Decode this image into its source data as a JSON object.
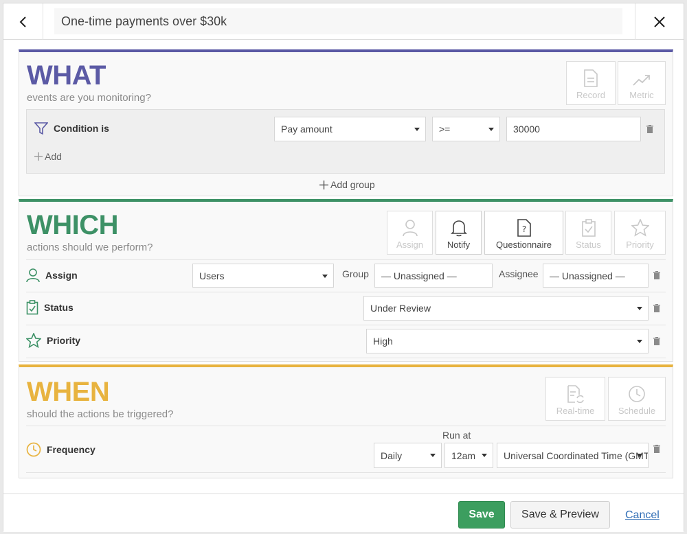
{
  "header": {
    "title": "One-time payments over $30k"
  },
  "what": {
    "title": "WHAT",
    "subtitle": "events are you monitoring?",
    "type_buttons": [
      {
        "label": "Record",
        "icon": "document-icon"
      },
      {
        "label": "Metric",
        "icon": "trend-icon"
      }
    ],
    "condition": {
      "label": "Condition is",
      "field": "Pay amount",
      "operator": ">=",
      "value": "30000"
    },
    "add_label": "Add",
    "add_group_label": "Add group"
  },
  "which": {
    "title": "WHICH",
    "subtitle": "actions should we perform?",
    "action_buttons": [
      {
        "label": "Assign",
        "icon": "user-icon"
      },
      {
        "label": "Notify",
        "icon": "bell-icon"
      },
      {
        "label": "Questionnaire",
        "icon": "question-doc-icon"
      },
      {
        "label": "Status",
        "icon": "clipboard-check-icon"
      },
      {
        "label": "Priority",
        "icon": "star-icon"
      }
    ],
    "assign": {
      "label": "Assign",
      "type": "Users",
      "group_label": "Group",
      "group_value": "— Unassigned —",
      "assignee_label": "Assignee",
      "assignee_value": "— Unassigned —"
    },
    "status": {
      "label": "Status",
      "value": "Under Review"
    },
    "priority": {
      "label": "Priority",
      "value": "High"
    }
  },
  "when": {
    "title": "WHEN",
    "subtitle": "should the actions be triggered?",
    "trigger_buttons": [
      {
        "label": "Real-time",
        "icon": "realtime-doc-icon"
      },
      {
        "label": "Schedule",
        "icon": "clock-icon"
      }
    ],
    "frequency": {
      "label": "Frequency",
      "value": "Daily",
      "run_at_label": "Run at",
      "time": "12am",
      "timezone": "Universal Coordinated Time (GMT)"
    }
  },
  "footer": {
    "save_label": "Save",
    "save_preview_label": "Save & Preview",
    "cancel_label": "Cancel"
  },
  "colors": {
    "what": "#5b5aa5",
    "which": "#3d9166",
    "when": "#e8b33f",
    "save": "#3c9e5f",
    "link": "#2f6db5"
  }
}
